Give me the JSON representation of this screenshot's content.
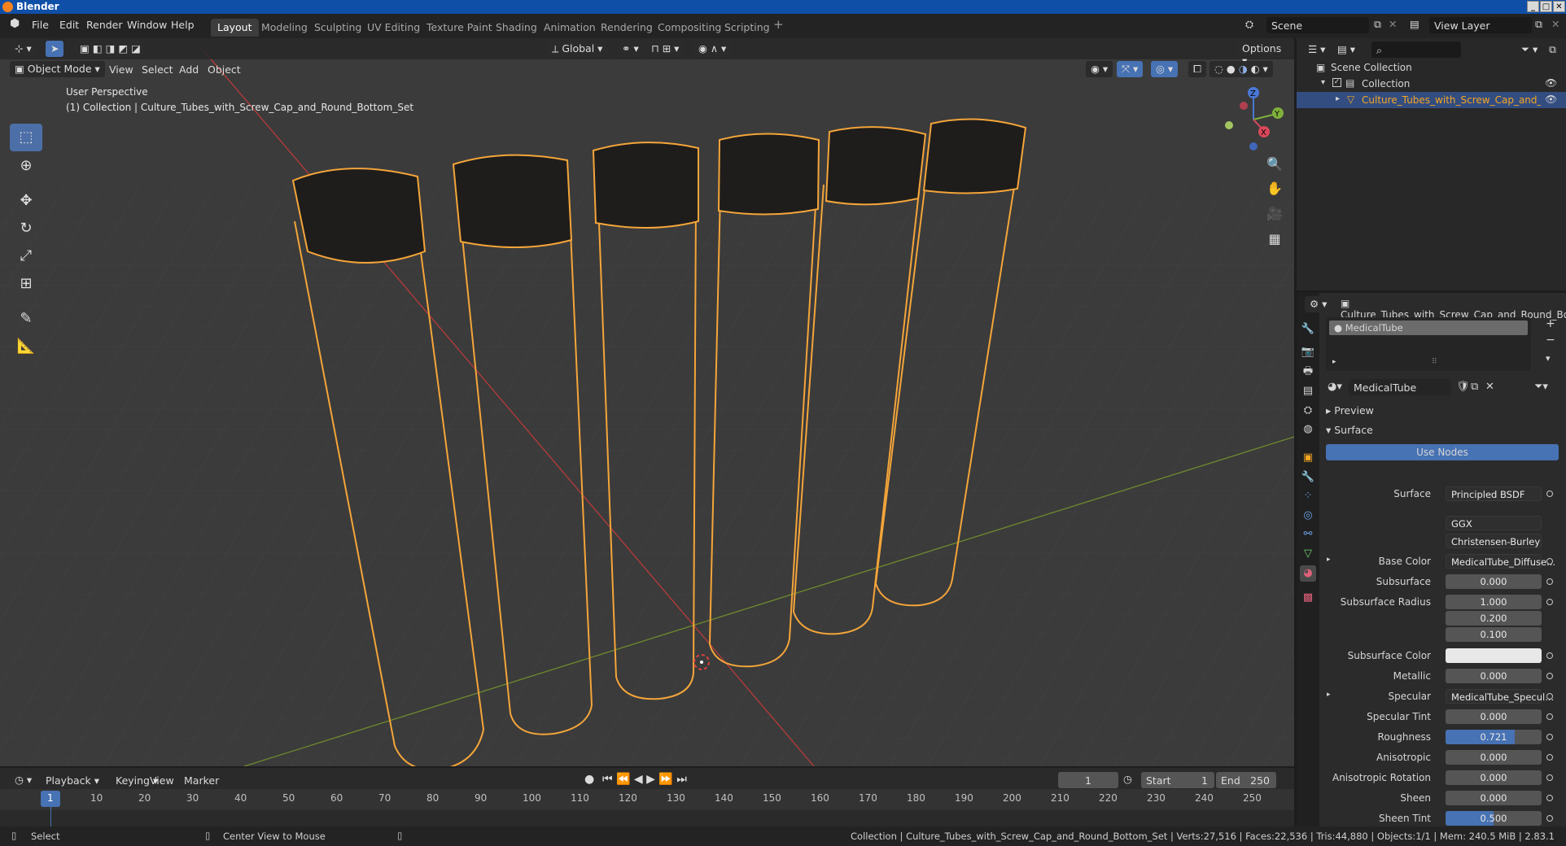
{
  "window": {
    "title": "Blender",
    "buttons": [
      "_",
      "□",
      "✕"
    ]
  },
  "menu": [
    "File",
    "Edit",
    "Render",
    "Window",
    "Help"
  ],
  "workspaces": [
    "Layout",
    "Modeling",
    "Sculpting",
    "UV Editing",
    "Texture Paint",
    "Shading",
    "Animation",
    "Rendering",
    "Compositing",
    "Scripting"
  ],
  "active_workspace": "Layout",
  "scene": {
    "name": "Scene",
    "view_layer": "View Layer"
  },
  "viewport": {
    "mode": "Object Mode",
    "header_menus": [
      "View",
      "Select",
      "Add",
      "Object"
    ],
    "transform_orientation": "Global",
    "options_label": "Options",
    "overlay_line1": "User Perspective",
    "overlay_line2": "(1) Collection | Culture_Tubes_with_Screw_Cap_and_Round_Bottom_Set",
    "gizmo": {
      "x": "X",
      "y": "Y",
      "z": "Z"
    }
  },
  "outliner": {
    "scene_collection": "Scene Collection",
    "collection": "Collection",
    "object": "Culture_Tubes_with_Screw_Cap_and_Round"
  },
  "properties": {
    "object_name": "Culture_Tubes_with_Screw_Cap_and_Round_Bottom",
    "material_slot": "MedicalTube",
    "material_name": "MedicalTube",
    "preview_label": "Preview",
    "surface_label": "Surface",
    "use_nodes": "Use Nodes",
    "rows": [
      {
        "label": "Surface",
        "value": "Principled BSDF",
        "kind": "dropdown"
      },
      {
        "label": "",
        "value": "GGX",
        "kind": "dropdown"
      },
      {
        "label": "",
        "value": "Christensen-Burley",
        "kind": "dropdown"
      },
      {
        "label": "Base Color",
        "value": "MedicalTube_Diffuse...",
        "kind": "dropdown"
      },
      {
        "label": "Subsurface",
        "value": "0.000",
        "kind": "number"
      },
      {
        "label": "Subsurface Radius",
        "value": "1.000",
        "kind": "number"
      },
      {
        "label": "",
        "value": "0.200",
        "kind": "number"
      },
      {
        "label": "",
        "value": "0.100",
        "kind": "number"
      },
      {
        "label": "Subsurface Color",
        "value": "",
        "kind": "color"
      },
      {
        "label": "Metallic",
        "value": "0.000",
        "kind": "number"
      },
      {
        "label": "Specular",
        "value": "MedicalTube_Specul...",
        "kind": "dropdown"
      },
      {
        "label": "Specular Tint",
        "value": "0.000",
        "kind": "number"
      },
      {
        "label": "Roughness",
        "value": "0.721",
        "kind": "slider",
        "fraction": 0.721
      },
      {
        "label": "Anisotropic",
        "value": "0.000",
        "kind": "number"
      },
      {
        "label": "Anisotropic Rotation",
        "value": "0.000",
        "kind": "number"
      },
      {
        "label": "Sheen",
        "value": "0.000",
        "kind": "number"
      },
      {
        "label": "Sheen Tint",
        "value": "0.500",
        "kind": "slider",
        "fraction": 0.5
      }
    ]
  },
  "timeline": {
    "menus": [
      "Playback",
      "Keying",
      "View",
      "Marker"
    ],
    "current_frame": "1",
    "start_label": "Start",
    "start": "1",
    "end_label": "End",
    "end": "250",
    "ticks": [
      "1",
      "10",
      "20",
      "30",
      "40",
      "50",
      "60",
      "70",
      "80",
      "90",
      "100",
      "110",
      "120",
      "130",
      "140",
      "150",
      "160",
      "170",
      "180",
      "190",
      "200",
      "210",
      "220",
      "230",
      "240",
      "250"
    ]
  },
  "status": {
    "left": "Select",
    "middle": "Center View to Mouse",
    "right": "Collection | Culture_Tubes_with_Screw_Cap_and_Round_Bottom_Set | Verts:27,516 | Faces:22,536 | Tris:44,880 | Objects:1/1 | Mem: 240.5 MiB | 2.83.1"
  },
  "colors": {
    "accent": "#4772b3",
    "selection_outline": "#f5a623",
    "title_bar": "#0f4fa8"
  }
}
